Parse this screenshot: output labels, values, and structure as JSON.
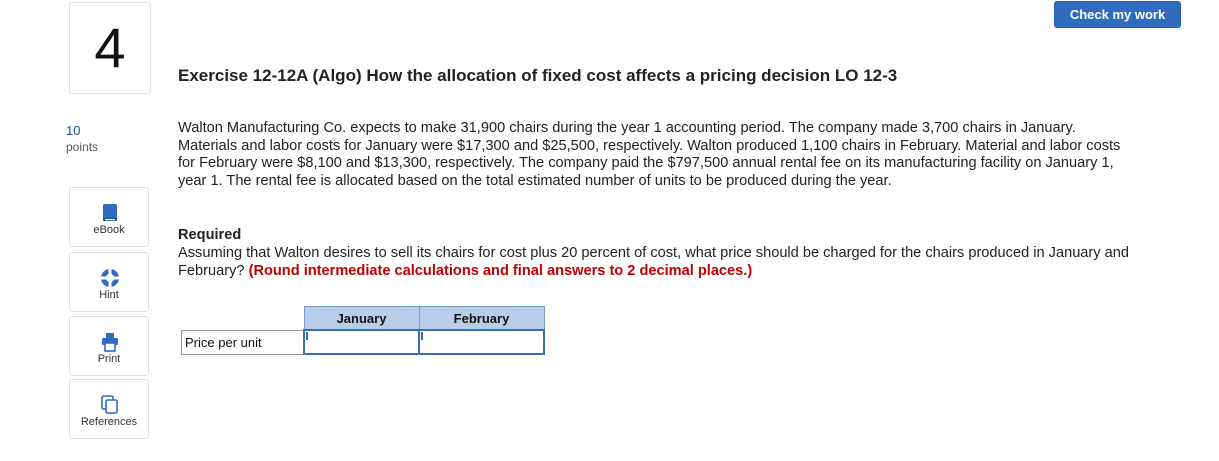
{
  "question": {
    "number": "4",
    "points_value": "10",
    "points_label": "points"
  },
  "toolbar": {
    "check_label": "Check my work"
  },
  "tools": [
    {
      "label": "eBook",
      "icon": "book-icon"
    },
    {
      "label": "Hint",
      "icon": "lifebuoy-icon"
    },
    {
      "label": "Print",
      "icon": "printer-icon"
    },
    {
      "label": "References",
      "icon": "copy-icon"
    }
  ],
  "exercise": {
    "title": "Exercise 12-12A (Algo) How the allocation of fixed cost affects a pricing decision LO 12-3",
    "body": "Walton Manufacturing Co. expects to make 31,900 chairs during the year 1 accounting period. The company made 3,700 chairs in January. Materials and labor costs for January were $17,300 and $25,500, respectively. Walton produced 1,100 chairs in February. Material and labor costs for February were $8,100 and $13,300, respectively. The company paid the $797,500 annual rental fee on its manufacturing facility on January 1, year 1. The rental fee is allocated based on the total estimated number of units to be produced during the year.",
    "required_heading": "Required",
    "required_text": "Assuming that Walton desires to sell its chairs for cost plus 20 percent of cost, what price should be charged for the chairs produced in January and February?",
    "instruction": "(Round intermediate calculations and final answers to 2 decimal places.)"
  },
  "answer_table": {
    "columns": [
      "January",
      "February"
    ],
    "row_label": "Price per unit",
    "values": [
      "",
      ""
    ]
  },
  "colors": {
    "accent": "#2f6cc0",
    "header_fill": "#b8cde9",
    "instruction_red": "#c00000"
  }
}
